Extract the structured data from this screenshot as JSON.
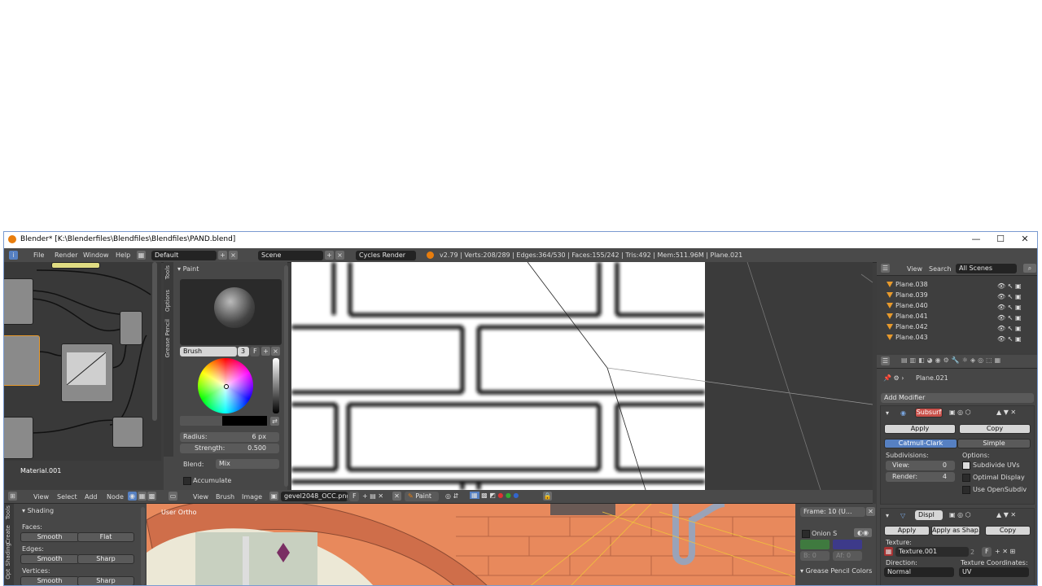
{
  "window": {
    "title": "Blender* [K:\\Blenderfiles\\Blendfiles\\Blendfiles\\PAND.blend]",
    "minimize": "—",
    "maximize": "☐",
    "close": "✕"
  },
  "menubar": {
    "items": [
      "File",
      "Render",
      "Window",
      "Help"
    ],
    "layout": "Default",
    "scene": "Scene",
    "engine": "Cycles Render",
    "stats": "v2.79 | Verts:208/289 | Edges:364/530 | Faces:155/242 | Tris:492 | Mem:511.96M | Plane.021"
  },
  "node_editor": {
    "material_label": "Material.001",
    "menu": [
      "View",
      "Select",
      "Add",
      "Node"
    ]
  },
  "tool_shelf": {
    "tabs": [
      "Tools",
      "Options",
      "Grease Pencil"
    ],
    "panel_title": "Paint",
    "brush_label": "Brush",
    "brush_users": "3",
    "brush_fake": "F",
    "radius_label": "Radius:",
    "radius_value": "6 px",
    "strength_label": "Strength:",
    "strength_value": "0.500",
    "blend_label": "Blend:",
    "blend_value": "Mix",
    "accumulate_label": "Accumulate"
  },
  "image_editor": {
    "menu": [
      "View",
      "Brush",
      "Image"
    ],
    "image_name": "gevel2048_OCC.png",
    "image_fake": "F",
    "mode": "Paint"
  },
  "outliner": {
    "menu": [
      "View",
      "Search"
    ],
    "filter": "All Scenes",
    "items": [
      "Plane.038",
      "Plane.039",
      "Plane.040",
      "Plane.041",
      "Plane.042",
      "Plane.043"
    ]
  },
  "properties": {
    "object_name": "Plane.021",
    "add_modifier": "Add Modifier",
    "subsurf": {
      "name": "Subsurf",
      "apply": "Apply",
      "copy": "Copy",
      "catmull": "Catmull-Clark",
      "simple": "Simple",
      "subdivisions_label": "Subdivisions:",
      "view_label": "View:",
      "view_value": "0",
      "render_label": "Render:",
      "render_value": "4",
      "options_label": "Options:",
      "opt1": "Subdivide UVs",
      "opt2": "Optimal Display",
      "opt3": "Use OpenSubdiv"
    },
    "displace": {
      "name": "Displ",
      "apply": "Apply",
      "apply_shape": "Apply as Shap...",
      "copy": "Copy",
      "texture_label": "Texture:",
      "texture_value": "Texture.001",
      "users": "2",
      "fake": "F",
      "direction_label": "Direction:",
      "direction_value": "Normal",
      "coords_label": "Texture Coordinates:",
      "coords_value": "UV"
    }
  },
  "bottom_left": {
    "tabs": [
      "Tools",
      "Create",
      "Shading",
      "Opt"
    ],
    "panel": "Shading",
    "faces_label": "Faces:",
    "edges_label": "Edges:",
    "vertices_label": "Vertices:",
    "smooth": "Smooth",
    "flat": "Flat",
    "sharp": "Sharp"
  },
  "viewport": {
    "label": "User Ortho"
  },
  "grease_pencil": {
    "frame": "Frame: 10 (U...",
    "onion": "Onion S",
    "b_value": "B: 0",
    "a_value": "Af: 0",
    "colors_title": "Grease Pencil Colors"
  }
}
